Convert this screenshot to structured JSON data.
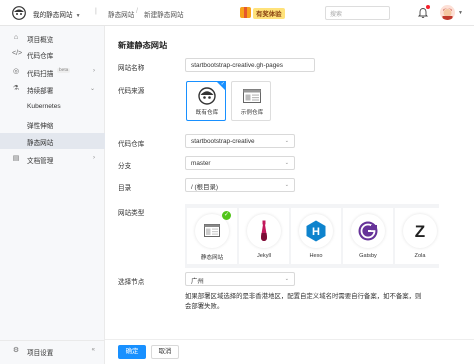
{
  "topbar": {
    "project_name": "我的静态网站",
    "breadcrumb": [
      "静态网站",
      "新建静态网站"
    ],
    "promo_text": "有奖体验",
    "search_placeholder": "搜索"
  },
  "sidebar": {
    "items": [
      {
        "label": "项目概览",
        "icon": "home-icon"
      },
      {
        "label": "代码仓库",
        "icon": "code-icon"
      },
      {
        "label": "代码扫描",
        "icon": "scan-icon",
        "badge": "beta"
      },
      {
        "label": "持续部署",
        "icon": "deploy-icon"
      },
      {
        "label": "Kubernetes"
      },
      {
        "label": "弹性伸缩"
      },
      {
        "label": "静态网站"
      },
      {
        "label": "文档管理",
        "icon": "doc-icon"
      }
    ],
    "bottom_label": "项目设置",
    "collapse_glyph": "«"
  },
  "form": {
    "title": "新建静态网站",
    "site_name_label": "网站名称",
    "site_name_value": "startbootstrap-creative.gh-pages",
    "source_label": "代码来源",
    "sources": [
      {
        "label": "既有仓库",
        "selected": true
      },
      {
        "label": "示例仓库",
        "selected": false
      }
    ],
    "repo_label": "代码仓库",
    "repo_value": "startbootstrap-creative",
    "branch_label": "分支",
    "branch_value": "master",
    "dir_label": "目录",
    "dir_value": "/ (根目录)",
    "type_label": "网站类型",
    "types": [
      {
        "label": "静态网站",
        "selected": true
      },
      {
        "label": "Jekyll"
      },
      {
        "label": "Hexo"
      },
      {
        "label": "Gatsby"
      },
      {
        "label": "Zola"
      }
    ],
    "node_label": "选择节点",
    "node_value": "广州",
    "note": "如果部署区域选择的是非香港地区，配置自定义域名时需要自行备案，如不备案，则会部署失败。",
    "ok_label": "确定",
    "cancel_label": "取消"
  },
  "colors": {
    "primary": "#1890ff",
    "success": "#52c41a",
    "hexo": "#0e83cd",
    "gatsby": "#663399",
    "jekyll": "#c2185b"
  }
}
